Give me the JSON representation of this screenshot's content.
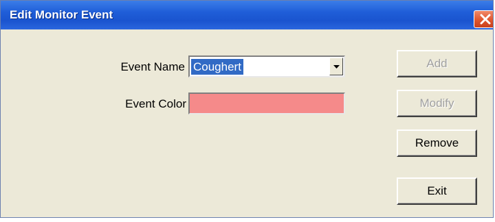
{
  "window": {
    "title": "Edit Monitor Event"
  },
  "form": {
    "event_name_label": "Event Name",
    "event_name_value": "Coughert",
    "event_color_label": "Event Color",
    "event_color_value": "#f58a8a"
  },
  "buttons": {
    "add": "Add",
    "modify": "Modify",
    "remove": "Remove",
    "exit": "Exit"
  },
  "colors": {
    "title_bar": "#1f5ed8",
    "dialog_background": "#ece9d8",
    "selection_highlight": "#316ac5",
    "close_button": "#e0562e"
  },
  "icons": {
    "close": "close-icon",
    "dropdown": "chevron-down-icon"
  },
  "state": {
    "add_enabled": false,
    "modify_enabled": false,
    "remove_enabled": true,
    "exit_enabled": true
  }
}
